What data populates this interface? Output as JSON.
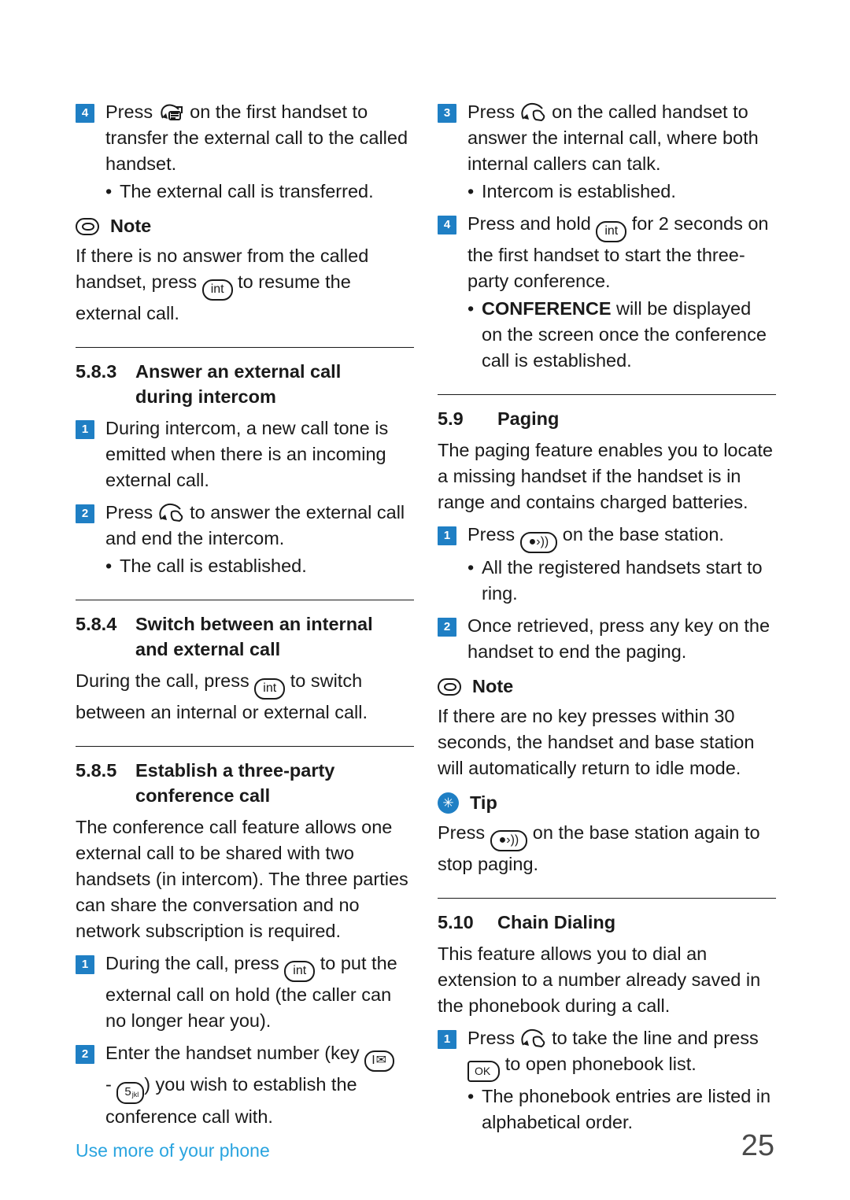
{
  "document": {
    "footer_label": "Use more of your phone",
    "page_number": "25"
  },
  "left_column": {
    "step4": {
      "num": "4",
      "text_before": "Press",
      "icon": "transfer-call-icon",
      "text_after": "on the first handset to transfer the external call to the called handset."
    },
    "bullet_transferred": {
      "dot": "•",
      "text": "The external call is transferred."
    },
    "note1": {
      "label": "Note",
      "text_before": "If there is no answer from the called handset, press",
      "key": "int",
      "text_after": "to resume the external call."
    },
    "section_583": {
      "number": "5.8.3",
      "title_line1": "Answer an external call",
      "title_line2": "during intercom"
    },
    "step583_1": {
      "num": "1",
      "text": "During intercom, a new call tone is emitted when there is an incoming external call."
    },
    "step583_2": {
      "num": "2",
      "text_before": "Press",
      "icon": "answer-call-icon",
      "text_after": "to answer the external call and end the intercom."
    },
    "bullet_call_established": {
      "dot": "•",
      "text": "The call is established."
    },
    "section_584": {
      "number": "5.8.4",
      "title_line1": "Switch between an internal",
      "title_line2": "and external call"
    },
    "para584": {
      "text_before": "During the call, press",
      "key": "int",
      "text_after": "to switch between an internal or external call."
    },
    "section_585": {
      "number": "5.8.5",
      "title_line1": "Establish a three-party",
      "title_line2": "conference call"
    },
    "para585": {
      "text": "The conference call feature allows one external call to be shared with two handsets (in intercom). The three parties can share the conversation and no network subscription is required."
    },
    "step585_1": {
      "num": "1",
      "text_before": "During the call, press",
      "key": "int",
      "text_after": "to put the external call on hold (the caller can no longer hear you)."
    },
    "step585_2": {
      "num": "2",
      "text_before": "Enter the handset number (key",
      "key_msg": "msg-key-icon",
      "text_middle": "-",
      "key_num": "5",
      "key_num_sub": "jkl",
      "text_after": ") you wish to establish the conference call with."
    }
  },
  "right_column": {
    "step3": {
      "num": "3",
      "text_before": "Press",
      "icon": "answer-call-icon",
      "text_after": "on the called handset to answer the internal call, where both internal callers can talk."
    },
    "bullet_intercom": {
      "dot": "•",
      "text": "Intercom is established."
    },
    "step4": {
      "num": "4",
      "text_before": "Press and hold",
      "key": "int",
      "text_after": "for 2 seconds on the first handset to start the three-party conference."
    },
    "bullet_conference": {
      "dot": "•",
      "strong": "CONFERENCE",
      "text": "will be displayed on the screen once the conference call is established."
    },
    "section_59": {
      "number": "5.9",
      "title_line1": "Paging"
    },
    "para59": {
      "text": "The paging feature enables you to locate a missing handset if the handset is in range and contains charged batteries."
    },
    "step59_1": {
      "num": "1",
      "text_before": "Press",
      "icon": "paging-key-icon",
      "text_after": "on the base station."
    },
    "bullet_ring": {
      "dot": "•",
      "text": "All the registered handsets start to ring."
    },
    "step59_2": {
      "num": "2",
      "text": "Once retrieved, press any key on the handset to end the paging."
    },
    "note2": {
      "label": "Note",
      "text": "If there are no key presses within 30 seconds, the handset and base station will automatically return to idle mode."
    },
    "tip": {
      "label": "Tip",
      "text_before": "Press",
      "icon": "paging-key-icon",
      "text_after": "on the base station again to stop paging."
    },
    "section_510": {
      "number": "5.10",
      "title_line1": "Chain Dialing"
    },
    "para510": {
      "text": "This feature allows you to dial an extension to a number already saved in the phonebook during a call."
    },
    "step510_1": {
      "num": "1",
      "text_before": "Press",
      "icon": "answer-call-icon",
      "text_middle": "to take the line and press",
      "key_ok": "OK",
      "text_after": "to open phonebook list."
    },
    "bullet_alpha": {
      "dot": "•",
      "text": "The phonebook entries are listed in alphabetical order."
    }
  },
  "colors": {
    "accent": "#1f7fc4",
    "footer": "#2aa4df",
    "text": "#1a1a1a"
  }
}
